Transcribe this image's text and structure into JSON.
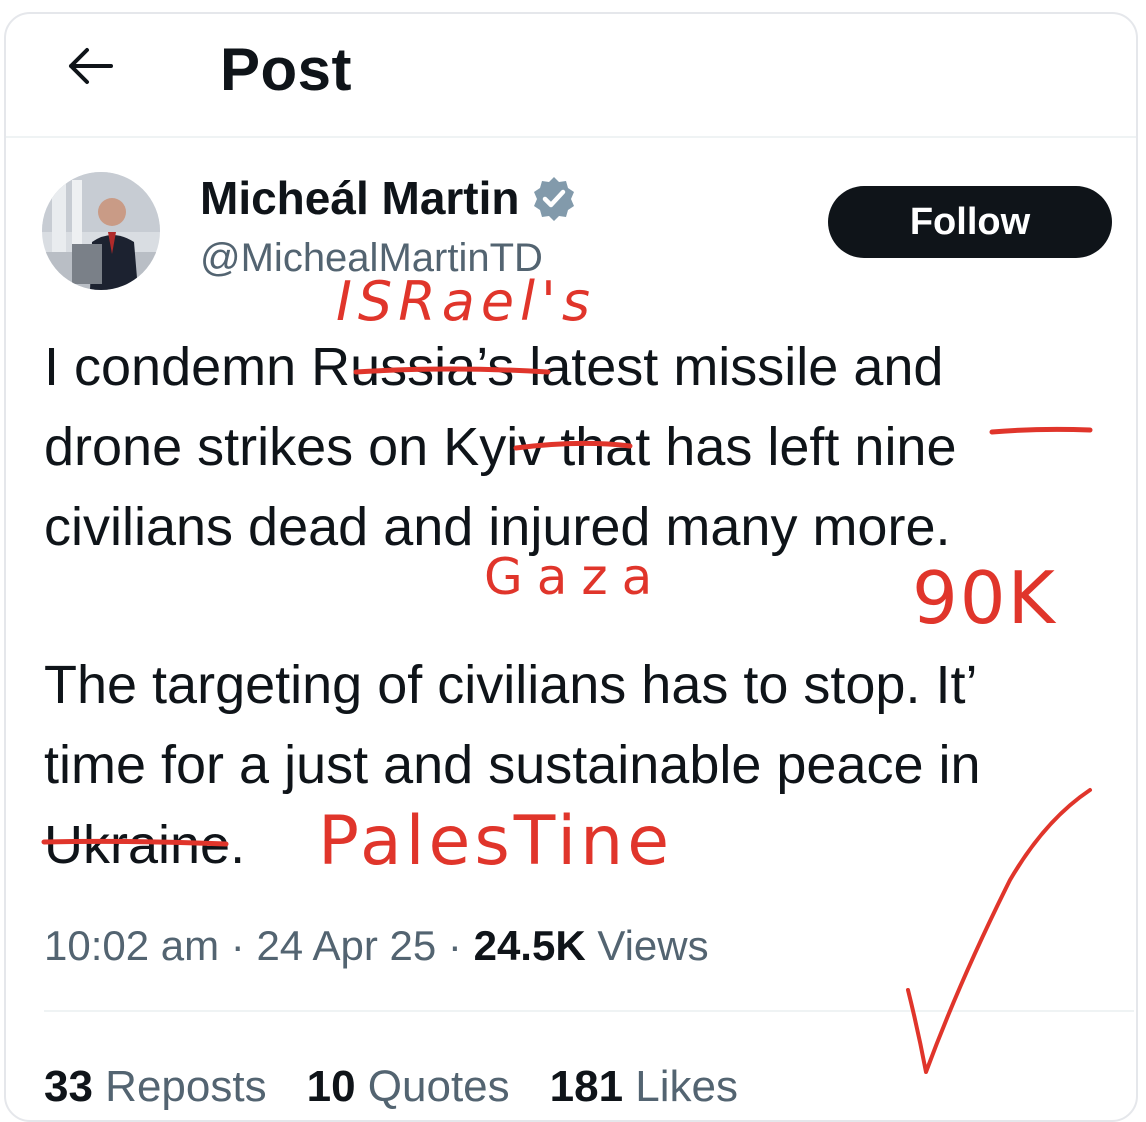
{
  "header": {
    "title": "Post",
    "back_icon": "arrow-left-icon"
  },
  "author": {
    "display_name": "Micheál Martin",
    "handle": "@MichealMartinTD",
    "verified_icon": "verified-badge-icon",
    "verified_color": "#829aab",
    "follow_label": "Follow"
  },
  "tweet": {
    "line1": {
      "before": "I condemn ",
      "struck": "Russia",
      "after": "’s latest missile and"
    },
    "line2": {
      "before": "drone strikes on ",
      "struck": "Kyiv",
      "middle": " that has left ",
      "struck2": "nine"
    },
    "line2_tail": "e",
    "line3": "civilians dead and injured many more.",
    "line4": "The targeting of civilians has to stop. It’",
    "line5": "time for a just and sustainable peace in",
    "line6": {
      "struck": "Ukrain",
      "after": "e."
    }
  },
  "annotations": {
    "israel": "ISRael's",
    "gaza": "Gaza",
    "count": "90K",
    "palestine": "PalesTine",
    "color": "#e0352b"
  },
  "meta": {
    "time": "10:02 am",
    "sep": " · ",
    "date": "24 Apr 25",
    "views_count": "24.5K",
    "views_label": " Views"
  },
  "stats": {
    "reposts_count": "33",
    "reposts_label": " Reposts",
    "quotes_count": "10",
    "quotes_label": " Quotes",
    "likes_count": "181",
    "likes_label": " Likes"
  }
}
